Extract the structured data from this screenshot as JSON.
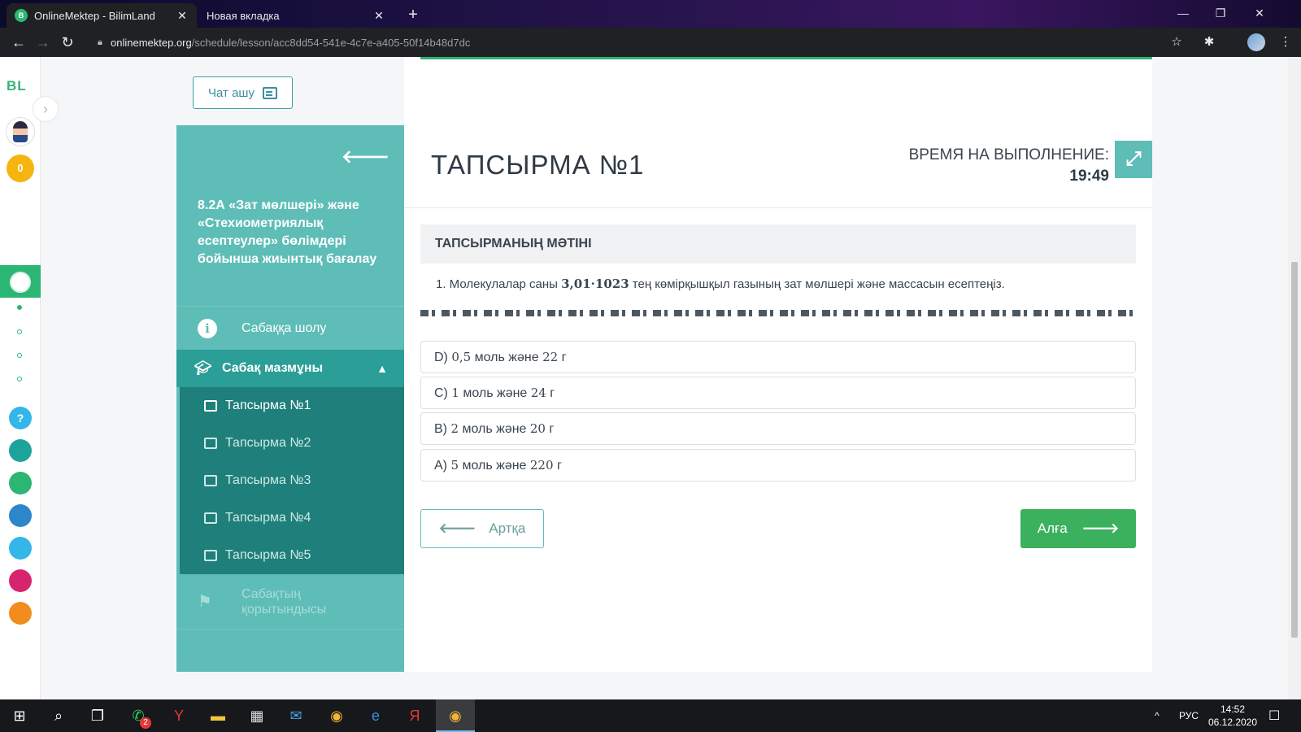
{
  "browser": {
    "tabs": [
      {
        "title": "OnlineMektep - BilimLand",
        "active": true
      },
      {
        "title": "Новая вкладка",
        "active": false
      }
    ],
    "url_host": "onlinemektep.org",
    "url_path": "/schedule/lesson/acc8dd54-541e-4c7e-a405-50f14b48d7dc"
  },
  "rail": {
    "logo": "BL",
    "coins": "0",
    "help": "?"
  },
  "chat_button": {
    "label": "Чат ашу"
  },
  "sidebar": {
    "lesson_title": "8.2А «Зат мөлшері» және «Стехиометриялық есептеулер» бөлімдері бойынша жиынтық бағалау",
    "overview": "Сабаққа шолу",
    "content": "Сабақ мазмұны",
    "tasks": [
      "Тапсырма №1",
      "Тапсырма №2",
      "Тапсырма №3",
      "Тапсырма №4",
      "Тапсырма №5"
    ],
    "summary": "Сабақтың қорытындысы"
  },
  "task": {
    "title": "ТАПСЫРМА №1",
    "timer_label": "ВРЕМЯ НА ВЫПОЛНЕНИЕ:",
    "timer_value": "19:49",
    "text_header": "ТАПСЫРМАНЫҢ МӘТІНІ",
    "question_prefix": "1. Молекулалар саны ",
    "question_value": "3,01·1023",
    "question_suffix": " тең көмірқышқыл газының зат мөлшері және массасын есептеңіз.",
    "options": [
      {
        "letter": "D) ",
        "value": "0,5",
        "mid": " моль және ",
        "value2": "22",
        "unit": " г"
      },
      {
        "letter": "C) ",
        "value": "1",
        "mid": " моль және ",
        "value2": "24",
        "unit": " г"
      },
      {
        "letter": "B) ",
        "value": "2",
        "mid": " моль және ",
        "value2": "20",
        "unit": " г"
      },
      {
        "letter": "A) ",
        "value": "5",
        "mid": " моль және ",
        "value2": "220",
        "unit": " г"
      }
    ],
    "back_label": "Артқа",
    "next_label": "Алға"
  },
  "taskbar": {
    "whatsapp_badge": "2",
    "lang": "РУС",
    "time": "14:52",
    "date": "06.12.2020"
  },
  "colors": {
    "accent_teal": "#5fbdb8",
    "active_teal": "#2a9e97",
    "sub_teal": "#1f7f7a",
    "green": "#3bb15d"
  }
}
